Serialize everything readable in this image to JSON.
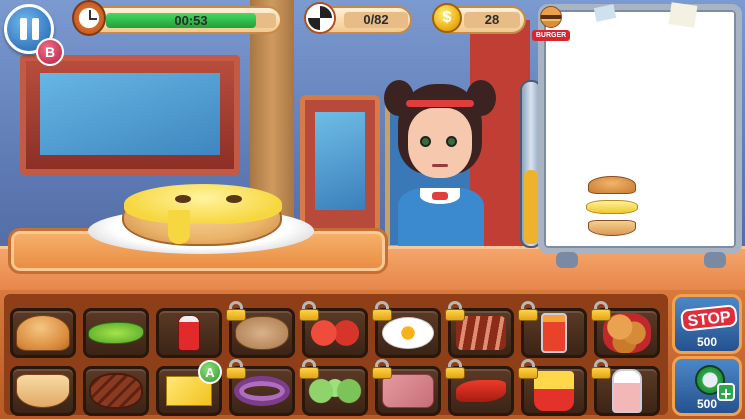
{
  "hud": {
    "pause_icon": "pause-icon",
    "b_badge": "B",
    "timer_text": "00:53",
    "timer_progress": 0.88,
    "orders_text": "0/82",
    "coins_text": "28",
    "burger_label": "BURGER"
  },
  "order_board": {
    "stack": [
      "bun-top",
      "cheese",
      "bun-bottom"
    ]
  },
  "plate_items": [
    "bun-bottom",
    "cheese"
  ],
  "shelf": {
    "row1": [
      {
        "name": "bun-top",
        "locked": false
      },
      {
        "name": "lettuce",
        "locked": false
      },
      {
        "name": "ketchup",
        "locked": false
      },
      {
        "name": "raw-patty",
        "locked": true
      },
      {
        "name": "tomato",
        "locked": true
      },
      {
        "name": "fried-egg",
        "locked": true
      },
      {
        "name": "bacon",
        "locked": true
      },
      {
        "name": "drink",
        "locked": true
      },
      {
        "name": "nuggets",
        "locked": true
      }
    ],
    "row2": [
      {
        "name": "bun-bottom",
        "locked": false
      },
      {
        "name": "cooked-patty",
        "locked": false
      },
      {
        "name": "cheese-slice",
        "locked": false
      },
      {
        "name": "onion",
        "locked": true
      },
      {
        "name": "cucumber",
        "locked": true
      },
      {
        "name": "ham",
        "locked": true
      },
      {
        "name": "chili-pepper",
        "locked": true
      },
      {
        "name": "fries",
        "locked": true
      },
      {
        "name": "milkshake",
        "locked": true
      }
    ],
    "a_badge": "A"
  },
  "powerups": {
    "stop": {
      "title": "STOP",
      "price": "500"
    },
    "time": {
      "price": "500"
    }
  },
  "colors": {
    "counter": "#e7864a",
    "shelf": "#b85a25",
    "hud_bg": "#f2c98e",
    "timer_fill": "#1f9f3b",
    "powerup_bg": "#24528f"
  }
}
